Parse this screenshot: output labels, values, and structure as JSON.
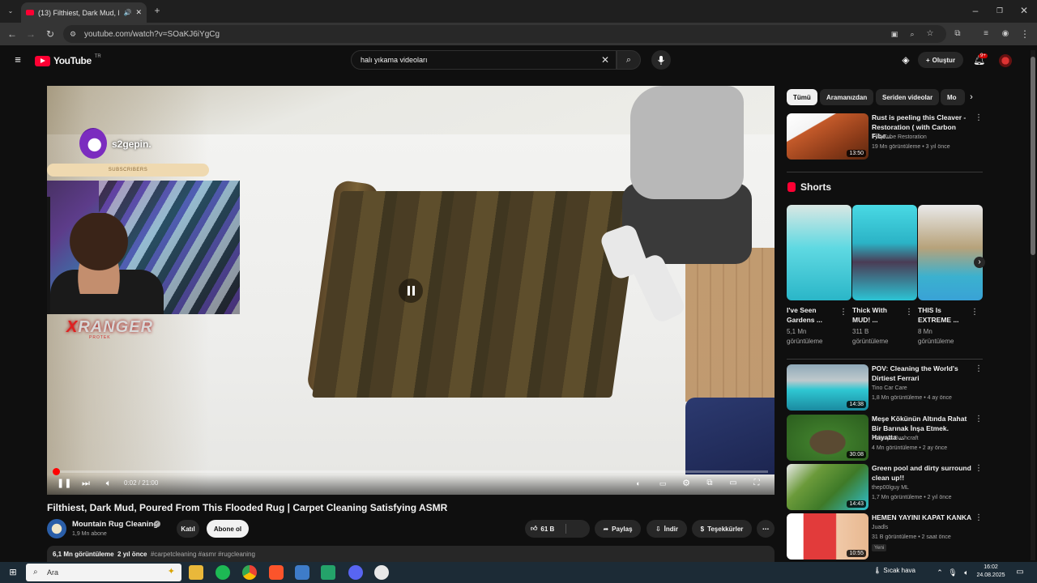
{
  "browser": {
    "tab_title": "(13) Filthiest, Dark Mud, Po",
    "url": "youtube.com/watch?v=SOaKJ6iYgCg"
  },
  "header": {
    "logo_text": "YouTube",
    "logo_region": "TR",
    "search_value": "halı yıkama videoları",
    "create_label": "Oluştur",
    "notif_count": "9+"
  },
  "player": {
    "overlay_sub_name": "s2gepin.",
    "overlay_sub_banner": "SUBSCRIBERS",
    "overlay_brand": "RANGER",
    "overlay_brand_x": "X",
    "overlay_brand_sub": "PROTEK",
    "time_current": "0:02",
    "time_sep": " / ",
    "time_total": "21:00",
    "progress": 0.002
  },
  "video": {
    "title": "Filthiest, Dark Mud, Poured From This Flooded Rug | Carpet Cleaning Satisfying ASMR",
    "channel": "Mountain Rug Cleaning",
    "subscribers": "1,9 Mn abone",
    "join_label": "Katıl",
    "subscribe_label": "Abone ol",
    "likes": "61 B",
    "share_label": "Paylaş",
    "download_label": "İndir",
    "thanks_label": "Teşekkürler",
    "views": "6,1 Mn görüntüleme",
    "age": "2 yıl önce",
    "tags": "#carpetcleaning #asmr #rugcleaning"
  },
  "sidebar": {
    "chips": [
      "Tümü",
      "Aramanızdan",
      "Seriden videolar",
      "Mo"
    ],
    "top_video": {
      "title": "Rust is peeling this Cleaver - Restoration ( with Carbon Fibe...",
      "channel": "TysyTube Restoration",
      "meta": "19 Mn görüntüleme  •  3 yıl önce",
      "duration": "13:50"
    },
    "shorts_title": "Shorts",
    "shorts": [
      {
        "title": "I've Seen Gardens ...",
        "views": "5,1 Mn görüntüleme"
      },
      {
        "title": "Thick With MUD! ...",
        "views": "311 B görüntüleme"
      },
      {
        "title": "THIS Is EXTREME ...",
        "views": "8 Mn görüntüleme"
      }
    ],
    "videos": [
      {
        "title": "POV: Cleaning the World's Dirtiest Ferrari",
        "channel": "Tino Car Care",
        "meta": "1,8 Mn görüntüleme  •  4 ay önce",
        "duration": "14:38",
        "badge": ""
      },
      {
        "title": "Meşe Kökünün Altında Rahat Bir Barınak İnşa Etmek. Hayatta ...",
        "channel": "Polissya Bushcraft",
        "meta": "4 Mn görüntüleme  •  2 ay önce",
        "duration": "30:08",
        "badge": ""
      },
      {
        "title": "Green pool and dirty surround clean up!!",
        "channel": "thep00lguy ML",
        "meta": "1,7 Mn görüntüleme  •  2 yıl önce",
        "duration": "14:43",
        "badge": ""
      },
      {
        "title": "HEMEN YAYINI KAPAT KANKA",
        "channel": "Juadls",
        "meta": "31 B görüntüleme  •  2 saat önce",
        "duration": "10:55",
        "badge": "Yeni"
      }
    ]
  },
  "taskbar": {
    "search_placeholder": "Ara",
    "weather": "Sıcak hava",
    "time": "16:02",
    "date": "24.08.2025"
  },
  "colors": {
    "accent": "#ff0033",
    "bg": "#0f0f0f",
    "chip": "#272727"
  },
  "icons": [
    "menu-icon",
    "search-icon",
    "mic-icon",
    "bell-icon",
    "play-pause-icon",
    "next-icon",
    "volume-icon",
    "settings-icon",
    "fullscreen-icon",
    "like-icon",
    "share-icon",
    "download-icon",
    "more-icon"
  ]
}
